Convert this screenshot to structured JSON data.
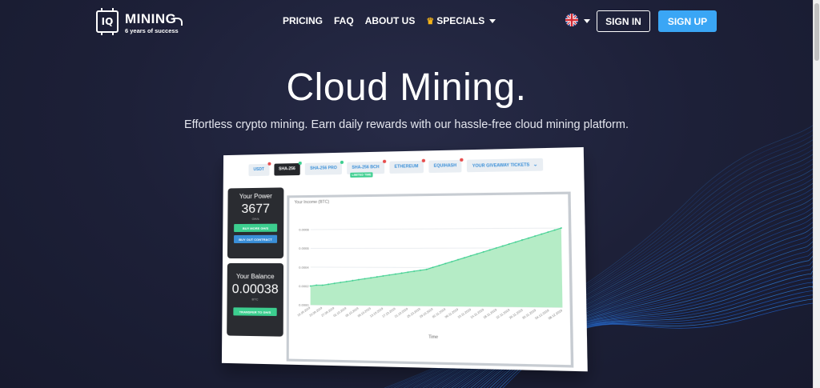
{
  "header": {
    "logo": {
      "chip_text": "IQ",
      "brand": "MINING",
      "tagline": "6 years of success"
    },
    "nav": [
      {
        "label": "PRICING"
      },
      {
        "label": "FAQ"
      },
      {
        "label": "ABOUT US"
      },
      {
        "label": "SPECIALS",
        "icon": "crown-icon",
        "has_dropdown": true
      }
    ],
    "language": {
      "icon": "uk-flag-icon",
      "has_dropdown": true
    },
    "sign_in": "SIGN IN",
    "sign_up": "SIGN UP"
  },
  "hero": {
    "title": "Cloud Mining.",
    "subtitle": "Effortless crypto mining. Earn daily rewards with our hassle-free cloud mining platform."
  },
  "dashboard": {
    "tabs": [
      {
        "label": "USDT",
        "dot": "#e74c4c"
      },
      {
        "label": "SHA-256",
        "dot": "#3cce8f",
        "active": true
      },
      {
        "label": "SHA-256 PRO",
        "dot": "#3cce8f"
      },
      {
        "label": "SHA-256 BCH",
        "dot": "#e74c4c",
        "badge": "LIMITED TIME"
      },
      {
        "label": "ETHEREUM",
        "dot": "#e74c4c"
      },
      {
        "label": "EQUIHASH",
        "dot": "#e74c4c"
      },
      {
        "label": "YOUR GIVEAWAY TICKETS",
        "has_dropdown": true
      }
    ],
    "power": {
      "title": "Your Power",
      "value": "3677",
      "unit": "GH/s",
      "buy_more": "BUY MORE GH/S",
      "buy_out": "BUY OUT CONTRACT"
    },
    "balance": {
      "title": "Your Balance",
      "value": "0.00038",
      "unit": "BTC",
      "transfer": "TRANSFER TO GH/S"
    },
    "income_chart_title": "Your Income (BTC)",
    "colors": {
      "accent_blue": "#3aa6f5",
      "green": "#3cce8f",
      "panel_dark": "#2a2c31"
    }
  },
  "chart_data": {
    "type": "area",
    "title": "Your Income (BTC)",
    "xlabel": "Time",
    "ylabel": "",
    "ylim": [
      0,
      0.0009
    ],
    "yticks": [
      "0.0000",
      "0.0002",
      "0.0004",
      "0.0006",
      "0.0008"
    ],
    "x": [
      "19.09.2019",
      "21.09.2019",
      "23.09.2019",
      "25.09.2019",
      "27.09.2019",
      "29.09.2019",
      "01.10.2019",
      "03.10.2019",
      "05.10.2019",
      "07.10.2019",
      "09.10.2019",
      "11.10.2019",
      "13.10.2019",
      "15.10.2019",
      "17.10.2019",
      "19.10.2019",
      "21.10.2019",
      "23.10.2019",
      "25.10.2019",
      "27.10.2019",
      "29.10.2019",
      "31.10.2019",
      "02.11.2019",
      "04.11.2019",
      "06.11.2019",
      "08.11.2019",
      "10.11.2019",
      "12.11.2019",
      "14.11.2019",
      "16.11.2019",
      "18.11.2019",
      "20.11.2019",
      "22.11.2019",
      "24.11.2019",
      "26.11.2019",
      "28.11.2019",
      "30.11.2019",
      "02.12.2019",
      "04.12.2019",
      "06.12.2019",
      "08.12.2019"
    ],
    "series": [
      {
        "values": [
          0.0002,
          0.00021,
          0.00021,
          0.00022,
          0.00023,
          0.00024,
          0.00025,
          0.00026,
          0.00027,
          0.00028,
          0.00029,
          0.0003,
          0.00031,
          0.00032,
          0.00033,
          0.00034,
          0.00035,
          0.00036,
          0.00037,
          0.00038,
          0.0004,
          0.00042,
          0.00044,
          0.00046,
          0.00048,
          0.0005,
          0.00052,
          0.00054,
          0.00056,
          0.00058,
          0.0006,
          0.00062,
          0.00064,
          0.00066,
          0.00068,
          0.0007,
          0.00072,
          0.00074,
          0.00076,
          0.00078,
          0.0008
        ]
      }
    ],
    "grid": true,
    "color": "#3cce8f"
  }
}
